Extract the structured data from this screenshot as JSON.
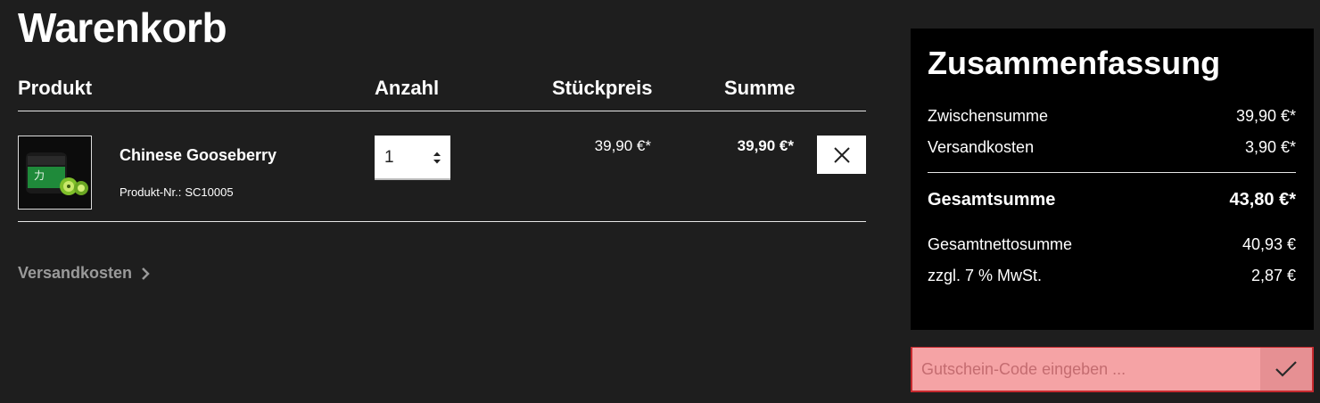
{
  "page": {
    "title": "Warenkorb"
  },
  "cart": {
    "columns": {
      "product": "Produkt",
      "quantity": "Anzahl",
      "unit_price": "Stückpreis",
      "total": "Summe"
    },
    "items": [
      {
        "name": "Chinese Gooseberry",
        "number_label": "Produkt-Nr.:",
        "number": "SC10005",
        "quantity": "1",
        "unit_price": "39,90 €*",
        "total": "39,90 €*"
      }
    ],
    "shipping_link": "Versandkosten"
  },
  "summary": {
    "title": "Zusammenfassung",
    "subtotal_label": "Zwischensumme",
    "subtotal": "39,90 €*",
    "shipping_label": "Versandkosten",
    "shipping": "3,90 €*",
    "total_label": "Gesamtsumme",
    "total": "43,80 €*",
    "net_label": "Gesamtnettosumme",
    "net": "40,93 €",
    "tax_label": "zzgl. 7 % MwSt.",
    "tax": "2,87 €"
  },
  "voucher": {
    "placeholder": "Gutschein-Code eingeben ..."
  },
  "icons": {
    "remove": "close-icon",
    "shipping_chevron": "chevron-right-icon",
    "voucher_submit": "checkmark-icon",
    "quantity_arrows": "sort-arrows-icon"
  },
  "colors": {
    "background": "#1e1e1e",
    "summary_bg": "#000000",
    "voucher_bg": "#f5a3a5",
    "voucher_border": "#c62a2f",
    "muted_link": "#9a9a9a"
  }
}
